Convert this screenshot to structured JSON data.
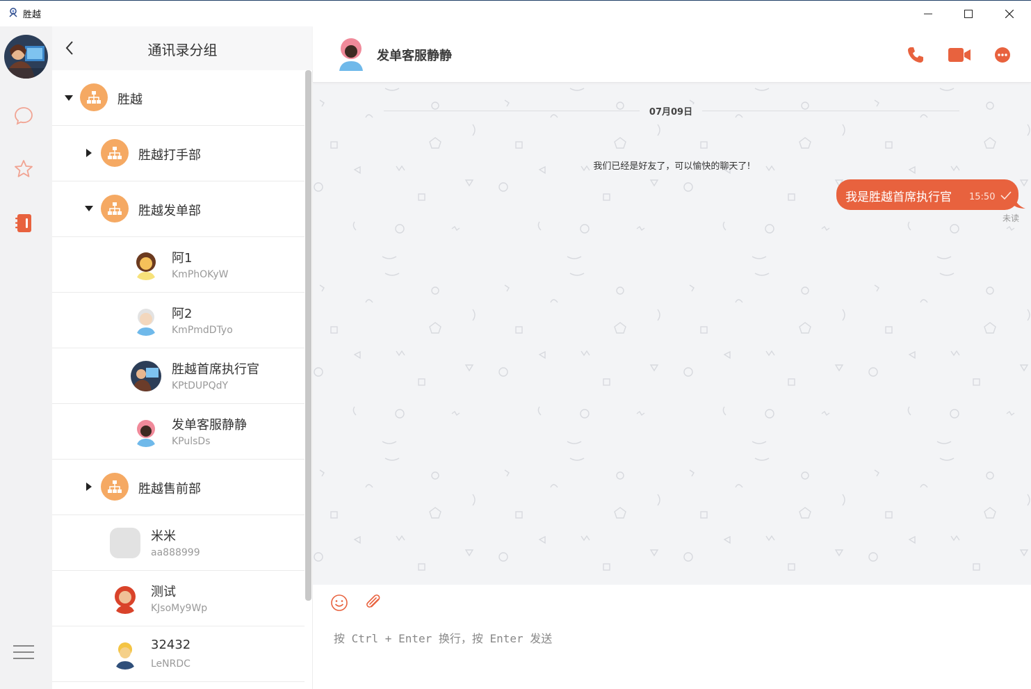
{
  "window": {
    "title": "胜越",
    "controls": {
      "minimize": "minimize-icon",
      "maximize": "maximize-icon",
      "close": "close-icon"
    }
  },
  "colors": {
    "accent": "#e8623e",
    "group_icon": "#f5a963",
    "rail_bg": "#f2f2f3",
    "chat_bg": "#f3f4f6"
  },
  "rail": {
    "items": [
      {
        "name": "chat-icon",
        "active": false
      },
      {
        "name": "star-icon",
        "active": false
      },
      {
        "name": "contacts-book-icon",
        "active": true
      }
    ],
    "menu_icon": "hamburger-menu-icon"
  },
  "contacts": {
    "title": "通讯录分组",
    "groups": [
      {
        "name": "胜越",
        "expanded": true,
        "level": 0
      },
      {
        "name": "胜越打手部",
        "expanded": false,
        "level": 1
      },
      {
        "name": "胜越发单部",
        "expanded": true,
        "level": 1
      },
      {
        "name": "胜越售前部",
        "expanded": false,
        "level": 1
      }
    ],
    "members": [
      {
        "name": "阿1",
        "id": "KmPhOKyW"
      },
      {
        "name": "阿2",
        "id": "KmPmdDTyo"
      },
      {
        "name": "胜越首席执行官",
        "id": "KPtDUPQdY"
      },
      {
        "name": "发单客服静静",
        "id": "KPulsDs"
      }
    ],
    "people": [
      {
        "name": "米米",
        "id": "aa888999"
      },
      {
        "name": "测试",
        "id": "KJsoMy9Wp"
      },
      {
        "name": "32432",
        "id": "LeNRDC"
      }
    ]
  },
  "chat": {
    "contact_name": "发单客服静静",
    "actions": [
      "phone-call-icon",
      "video-call-icon",
      "more-options-icon"
    ],
    "date": "07月09日",
    "system_message": "我们已经是好友了，可以愉快的聊天了!",
    "messages": [
      {
        "text": "我是胜越首席执行官",
        "time": "15:50",
        "status": "未读",
        "outgoing": true
      }
    ],
    "composer": {
      "tools": [
        "emoji-icon",
        "attachment-icon"
      ],
      "placeholder": "按 Ctrl + Enter 换行，按 Enter 发送"
    }
  }
}
